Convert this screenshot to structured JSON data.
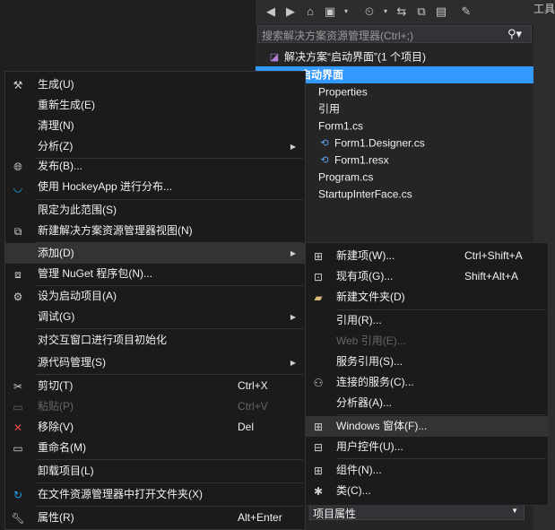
{
  "solution_explorer": {
    "search_placeholder": "搜索解决方案资源管理器(Ctrl+;)",
    "tree": [
      {
        "label": "解决方案“启动界面”(1 个项目)",
        "icon": "solution-icon",
        "indent": 0
      },
      {
        "label": "启动界面",
        "icon": "csharp-project-icon",
        "indent": 1,
        "selected": true
      },
      {
        "label": "Properties",
        "icon": "wrench-icon",
        "indent": 2
      },
      {
        "label": "引用",
        "icon": "references-icon",
        "indent": 2
      },
      {
        "label": "Form1.cs",
        "icon": "form-icon",
        "indent": 2
      },
      {
        "label": "Form1.Designer.cs",
        "icon": "csharp-file-icon",
        "indent": 3
      },
      {
        "label": "Form1.resx",
        "icon": "resx-file-icon",
        "indent": 3
      },
      {
        "label": "Program.cs",
        "icon": "csharp-file-icon",
        "indent": 2
      },
      {
        "label": "StartupInterFace.cs",
        "icon": "csharp-file-icon",
        "indent": 2
      }
    ],
    "properties_dropdown": "项目属性"
  },
  "right_panel": {
    "tab_label": "工具"
  },
  "context_menu": {
    "items": [
      {
        "label": "生成(U)",
        "icon": "build-icon"
      },
      {
        "label": "重新生成(E)"
      },
      {
        "label": "清理(N)"
      },
      {
        "label": "分析(Z)",
        "submenu": true
      },
      {
        "sep": true
      },
      {
        "label": "发布(B)...",
        "icon": "globe-icon"
      },
      {
        "label": "使用 HockeyApp 进行分布...",
        "icon": "hockeyapp-icon"
      },
      {
        "sep": true
      },
      {
        "label": "限定为此范围(S)"
      },
      {
        "label": "新建解决方案资源管理器视图(N)",
        "icon": "new-view-icon"
      },
      {
        "sep": true
      },
      {
        "label": "添加(D)",
        "submenu": true,
        "hover": true
      },
      {
        "label": "管理 NuGet 程序包(N)...",
        "icon": "nuget-icon"
      },
      {
        "sep": true
      },
      {
        "label": "设为启动项目(A)",
        "icon": "gear-icon"
      },
      {
        "label": "调试(G)",
        "submenu": true
      },
      {
        "sep": true
      },
      {
        "label": "对交互窗口进行项目初始化"
      },
      {
        "label": "源代码管理(S)",
        "submenu": true
      },
      {
        "sep": true
      },
      {
        "label": "剪切(T)",
        "shortcut": "Ctrl+X",
        "icon": "cut-icon"
      },
      {
        "label": "粘贴(P)",
        "shortcut": "Ctrl+V",
        "icon": "paste-icon",
        "disabled": true
      },
      {
        "label": "移除(V)",
        "shortcut": "Del",
        "icon": "remove-icon"
      },
      {
        "label": "重命名(M)",
        "icon": "rename-icon"
      },
      {
        "sep": true
      },
      {
        "label": "卸载项目(L)"
      },
      {
        "sep": true
      },
      {
        "label": "在文件资源管理器中打开文件夹(X)",
        "icon": "refresh-icon"
      },
      {
        "sep": true
      },
      {
        "label": "属性(R)",
        "shortcut": "Alt+Enter",
        "icon": "wrench-icon"
      }
    ]
  },
  "add_submenu": {
    "items": [
      {
        "label": "新建项(W)...",
        "shortcut": "Ctrl+Shift+A",
        "icon": "new-item-icon"
      },
      {
        "label": "现有项(G)...",
        "shortcut": "Shift+Alt+A",
        "icon": "existing-item-icon"
      },
      {
        "label": "新建文件夹(D)",
        "icon": "new-folder-icon"
      },
      {
        "sep": true
      },
      {
        "label": "引用(R)..."
      },
      {
        "label": "Web 引用(E)...",
        "disabled": true
      },
      {
        "label": "服务引用(S)..."
      },
      {
        "label": "连接的服务(C)...",
        "icon": "connected-service-icon"
      },
      {
        "label": "分析器(A)..."
      },
      {
        "sep": true
      },
      {
        "label": "Windows 窗体(F)...",
        "icon": "windows-form-icon",
        "hover": true
      },
      {
        "label": "用户控件(U)...",
        "icon": "user-control-icon"
      },
      {
        "sep": true
      },
      {
        "label": "组件(N)...",
        "icon": "component-icon"
      },
      {
        "label": "类(C)...",
        "icon": "class-icon"
      }
    ]
  },
  "colors": {
    "accent": "#3399ff",
    "menu_bg": "#1b1b1c",
    "hover_bg": "#333334"
  }
}
